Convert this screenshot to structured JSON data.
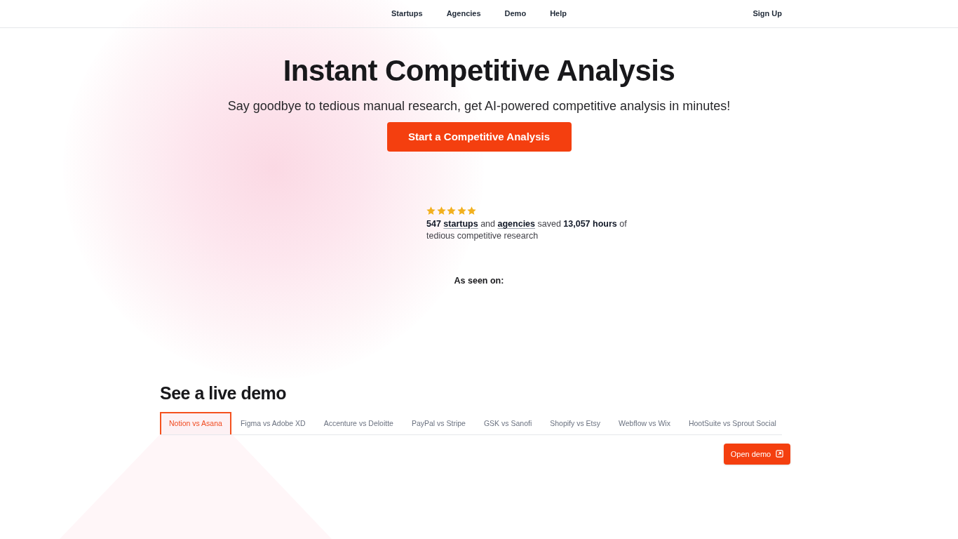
{
  "nav": {
    "links": [
      {
        "label": "Startups"
      },
      {
        "label": "Agencies"
      },
      {
        "label": "Demo"
      },
      {
        "label": "Help"
      }
    ],
    "sign_up": "Sign Up"
  },
  "hero": {
    "title": "Instant Competitive Analysis",
    "subtitle": "Say goodbye to tedious manual research, get AI-powered competitive analysis in minutes!",
    "cta": "Start a Competitive Analysis"
  },
  "social_proof": {
    "stars": 5,
    "segments": [
      {
        "kind": "strong",
        "text": "547"
      },
      {
        "kind": "link",
        "text": "startups"
      },
      {
        "kind": "plain",
        "text": "and"
      },
      {
        "kind": "link",
        "text": "agencies"
      },
      {
        "kind": "plain",
        "text": "saved"
      },
      {
        "kind": "strong",
        "text": "13,057 hours"
      },
      {
        "kind": "plain",
        "text": "of tedious competitive research"
      }
    ],
    "as_seen_on": "As seen on:"
  },
  "demo": {
    "title": "See a live demo",
    "tabs": [
      {
        "label": "Notion vs Asana",
        "selected": true
      },
      {
        "label": "Figma vs Adobe XD",
        "selected": false
      },
      {
        "label": "Accenture vs Deloitte",
        "selected": false
      },
      {
        "label": "PayPal vs Stripe",
        "selected": false
      },
      {
        "label": "GSK vs Sanofi",
        "selected": false
      },
      {
        "label": "Shopify vs Etsy",
        "selected": false
      },
      {
        "label": "Webflow vs Wix",
        "selected": false
      },
      {
        "label": "HootSuite vs Sprout Social",
        "selected": false
      }
    ],
    "open_demo": "Open demo"
  }
}
